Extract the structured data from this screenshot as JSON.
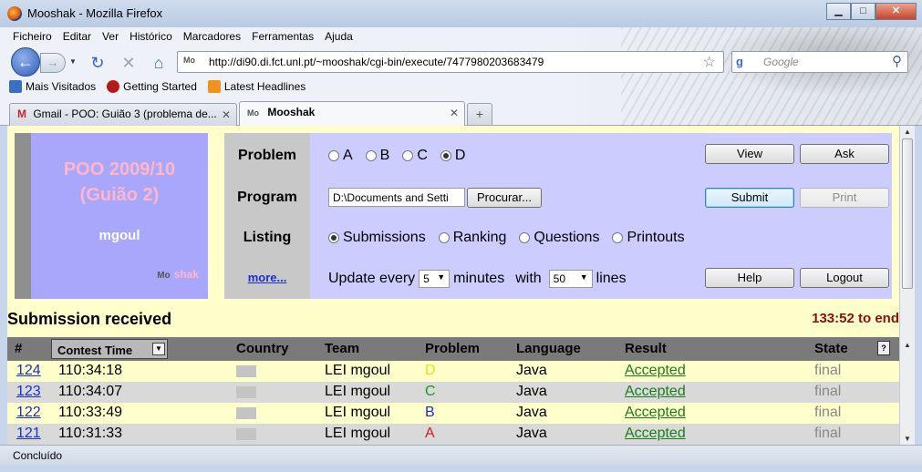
{
  "window": {
    "title": "Mooshak - Mozilla Firefox",
    "minimize": "▁",
    "maximize": "□",
    "close": "✕"
  },
  "menu": [
    "Ficheiro",
    "Editar",
    "Ver",
    "Histórico",
    "Marcadores",
    "Ferramentas",
    "Ajuda"
  ],
  "nav": {
    "url": "http://di90.di.fct.unl.pt/~mooshak/cgi-bin/execute/7477980203683479",
    "search_placeholder": "Google",
    "site_icon_text": "Mo"
  },
  "bookmarks": [
    {
      "label": "Mais Visitados",
      "icon": "bookmark-icon",
      "color": "#3a6fc4"
    },
    {
      "label": "Getting Started",
      "icon": "firefox-icon",
      "color": "#b51a1a"
    },
    {
      "label": "Latest Headlines",
      "icon": "rss-icon",
      "color": "#f0921e"
    }
  ],
  "tabs": [
    {
      "label": "Gmail - POO: Guião 3 (problema de...",
      "icon": "M",
      "active": false
    },
    {
      "label": "Mooshak",
      "icon": "Mo",
      "active": true
    }
  ],
  "logo": {
    "title_line1": "POO 2009/10",
    "title_line2": "(Guião 2)",
    "user": "mgoul",
    "brand_icon": "Mo",
    "brand": "shak"
  },
  "left_nav": {
    "problem": "Problem",
    "program": "Program",
    "listing": "Listing",
    "more": "more..."
  },
  "problem": {
    "options": [
      "A",
      "B",
      "C",
      "D"
    ],
    "selected": "D"
  },
  "program": {
    "file_value": "D:\\Documents and Setti",
    "browse_label": "Procurar..."
  },
  "listing": {
    "options": [
      "Submissions",
      "Ranking",
      "Questions",
      "Printouts"
    ],
    "selected": "Submissions"
  },
  "update": {
    "prefix": "Update every",
    "minutes_value": "5",
    "minutes_label": "minutes",
    "with_label": "with",
    "lines_value": "50",
    "lines_label": "lines"
  },
  "buttons": {
    "view": "View",
    "ask": "Ask",
    "submit": "Submit",
    "print": "Print",
    "help": "Help",
    "logout": "Logout"
  },
  "status": {
    "message": "Submission received",
    "time_left": "133:52 to end"
  },
  "table": {
    "headers": {
      "num": "#",
      "time": "Contest Time",
      "country": "Country",
      "team": "Team",
      "problem": "Problem",
      "language": "Language",
      "result": "Result",
      "state": "State"
    },
    "rows": [
      {
        "num": "124",
        "time": "110:34:18",
        "team": "LEI mgoul",
        "problem": "D",
        "problem_color": "#e6e600",
        "language": "Java",
        "result": "Accepted",
        "state": "final"
      },
      {
        "num": "123",
        "time": "110:34:07",
        "team": "LEI mgoul",
        "problem": "C",
        "problem_color": "#1a9a1a",
        "language": "Java",
        "result": "Accepted",
        "state": "final"
      },
      {
        "num": "122",
        "time": "110:33:49",
        "team": "LEI mgoul",
        "problem": "B",
        "problem_color": "#1a2fd0",
        "language": "Java",
        "result": "Accepted",
        "state": "final"
      },
      {
        "num": "121",
        "time": "110:31:33",
        "team": "LEI mgoul",
        "problem": "A",
        "problem_color": "#e01a1a",
        "language": "Java",
        "result": "Accepted",
        "state": "final"
      }
    ]
  },
  "statusbar": "Concluído"
}
